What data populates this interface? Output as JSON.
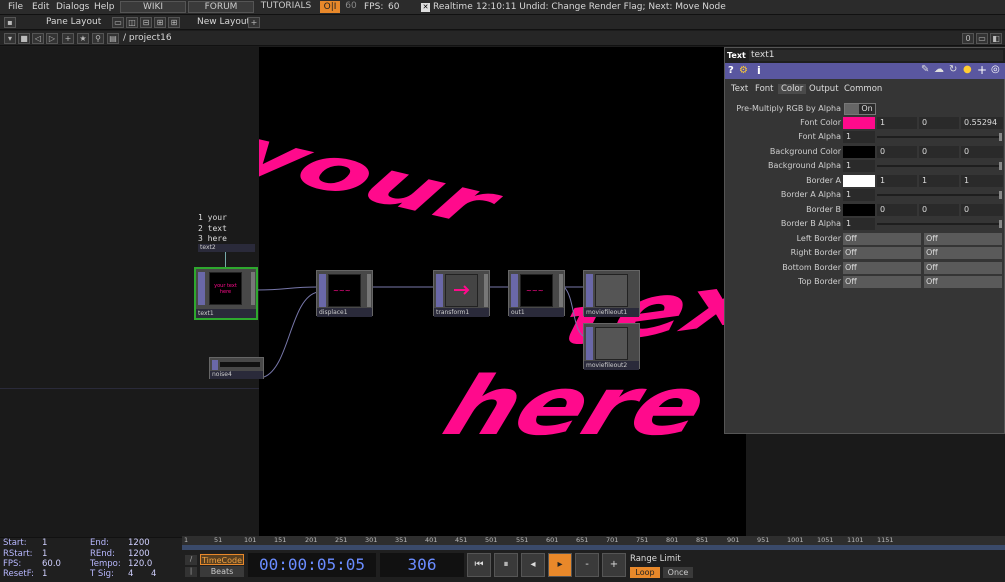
{
  "menu": {
    "file": "File",
    "edit": "Edit",
    "dialogs": "Dialogs",
    "help": "Help",
    "wiki": "WIKI",
    "forum": "FORUM",
    "tutorials": "TUTORIALS",
    "oi": "O|I",
    "fps_target": "60",
    "fps_label": "FPS:",
    "fps_value": "60",
    "realtime": "Realtime",
    "status": "12:10:11 Undid: Change Render Flag; Next: Move Node"
  },
  "toolbar": {
    "pane_layout": "Pane Layout",
    "new_layout": "New Layout",
    "path": "/ project16",
    "page_num": "0"
  },
  "network": {
    "text_lines": [
      "your",
      "text",
      "here"
    ],
    "text_line_nums": [
      "1",
      "2",
      "3"
    ],
    "nodes": {
      "text2": "text2",
      "text1": "text1",
      "displace1": "displace1",
      "transform1": "transform1",
      "out1": "out1",
      "moviefileout1": "moviefileout1",
      "moviefileout2": "moviefileout2",
      "noise4": "noise4"
    },
    "thumb_text": "your text here"
  },
  "viewer": {
    "word1": "your",
    "word2": "text",
    "word3": "here",
    "color": "#ff0a8c"
  },
  "params": {
    "op_type": "Text",
    "op_name": "text1",
    "tabs": [
      "Text",
      "Font",
      "Color",
      "Output",
      "Common"
    ],
    "rows": [
      {
        "label": "Pre-Multiply RGB by Alpha",
        "value": "On"
      },
      {
        "label": "Font Color",
        "v1": "1",
        "v2": "0",
        "v3": "0.55294",
        "swatch": "#ff0a8c"
      },
      {
        "label": "Font Alpha",
        "v1": "1"
      },
      {
        "label": "Background Color",
        "v1": "0",
        "v2": "0",
        "v3": "0",
        "swatch": "#000000"
      },
      {
        "label": "Background Alpha",
        "v1": "1"
      },
      {
        "label": "Border A",
        "v1": "1",
        "v2": "1",
        "v3": "1",
        "swatch": "#ffffff"
      },
      {
        "label": "Border A Alpha",
        "v1": "1"
      },
      {
        "label": "Border B",
        "v1": "0",
        "v2": "0",
        "v3": "0",
        "swatch": "#000000"
      },
      {
        "label": "Border B Alpha",
        "v1": "1"
      },
      {
        "label": "Left Border",
        "d1": "Off",
        "d2": "Off"
      },
      {
        "label": "Right Border",
        "d1": "Off",
        "d2": "Off"
      },
      {
        "label": "Bottom Border",
        "d1": "Off",
        "d2": "Off"
      },
      {
        "label": "Top Border",
        "d1": "Off",
        "d2": "Off"
      }
    ]
  },
  "timeline": {
    "start_label": "Start:",
    "start": "1",
    "end_label": "End:",
    "end": "1200",
    "rstart_label": "RStart:",
    "rstart": "1",
    "rend_label": "REnd:",
    "rend": "1200",
    "fps_label": "FPS:",
    "fps": "60.0",
    "tempo_label": "Tempo:",
    "tempo": "120.0",
    "resetf_label": "ResetF:",
    "resetf": "1",
    "tsig_label": "T Sig:",
    "tsig1": "4",
    "tsig2": "4",
    "timecode_btn": "TimeCode",
    "beats_btn": "Beats",
    "timecode": "00:00:05:05",
    "frame": "306",
    "range_limit": "Range Limit",
    "loop": "Loop",
    "once": "Once",
    "ticks": [
      "1",
      "51",
      "101",
      "151",
      "201",
      "251",
      "301",
      "351",
      "401",
      "451",
      "501",
      "551",
      "601",
      "651",
      "701",
      "751",
      "801",
      "851",
      "901",
      "951",
      "1001",
      "1051",
      "1101",
      "1151"
    ]
  },
  "colors": {
    "accent": "#e8882a",
    "node_purple": "#6a68a8",
    "pink": "#ff0a8c"
  }
}
